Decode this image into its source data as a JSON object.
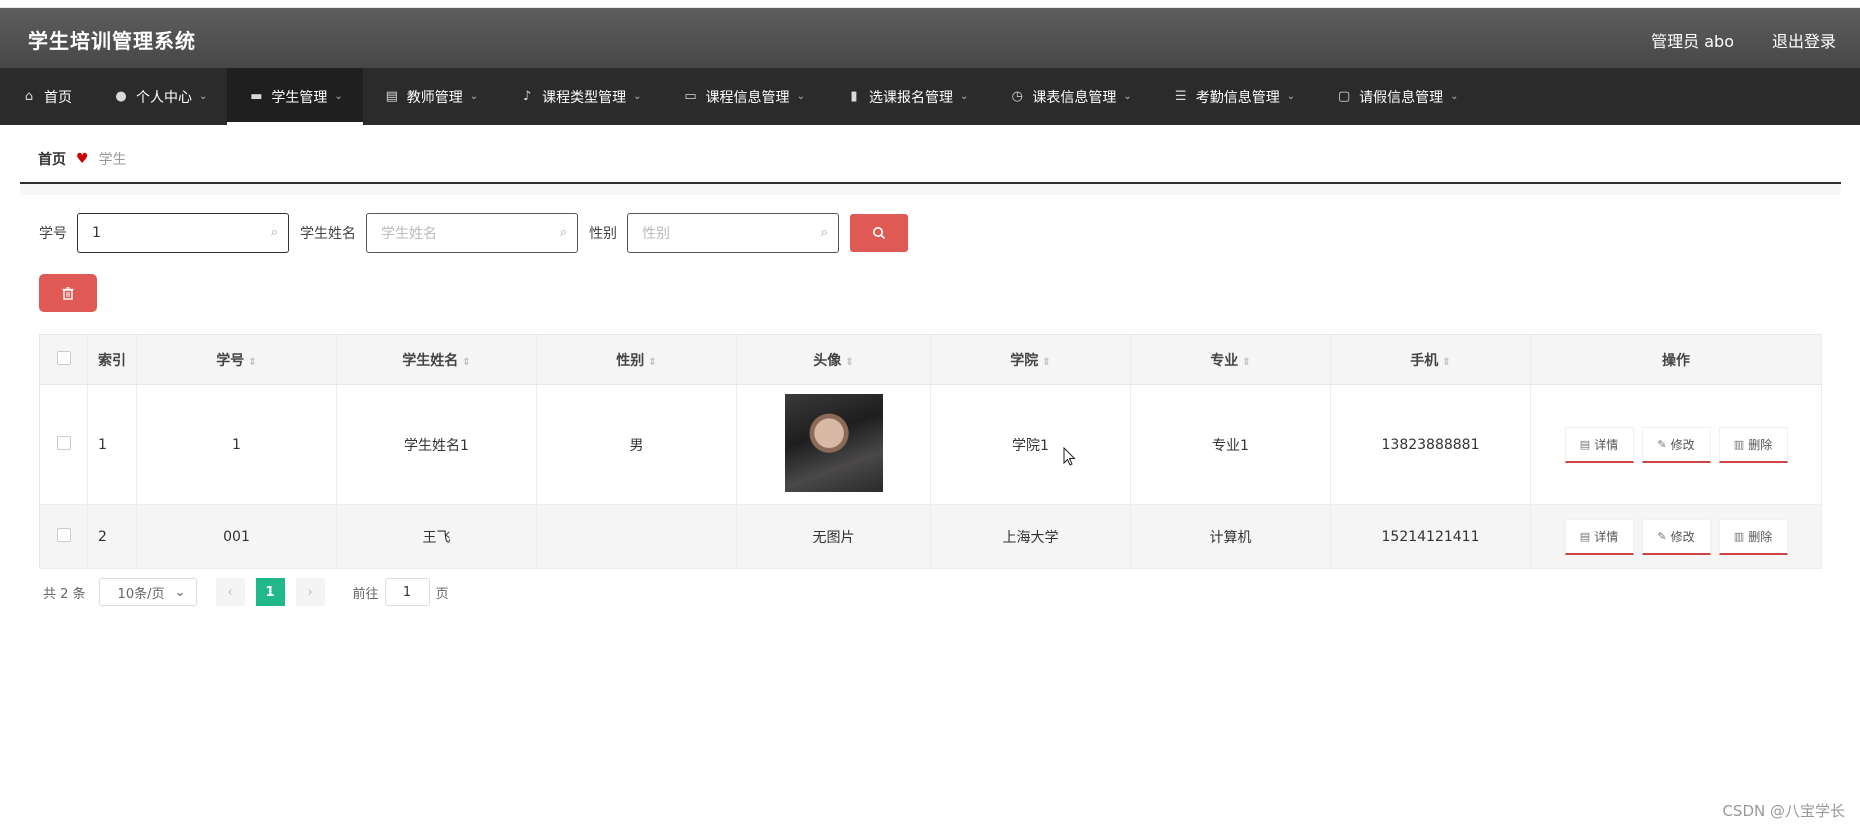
{
  "header": {
    "title": "学生培训管理系统",
    "user": "管理员 abo",
    "logout": "退出登录"
  },
  "nav": [
    {
      "label": "首页",
      "icon": "home-icon",
      "glyph": "⌂"
    },
    {
      "label": "个人中心",
      "icon": "person-icon",
      "glyph": "●",
      "dropdown": true
    },
    {
      "label": "学生管理",
      "icon": "monitor-icon",
      "glyph": "▬",
      "dropdown": true,
      "active": true
    },
    {
      "label": "教师管理",
      "icon": "clipboard-icon",
      "glyph": "▤",
      "dropdown": true
    },
    {
      "label": "课程类型管理",
      "icon": "microphone-icon",
      "glyph": "♪",
      "dropdown": true
    },
    {
      "label": "课程信息管理",
      "icon": "ticket-icon",
      "glyph": "▭",
      "dropdown": true
    },
    {
      "label": "选课报名管理",
      "icon": "bar-chart-icon",
      "glyph": "▮",
      "dropdown": true
    },
    {
      "label": "课表信息管理",
      "icon": "clock-icon",
      "glyph": "◷",
      "dropdown": true
    },
    {
      "label": "考勤信息管理",
      "icon": "list-icon",
      "glyph": "☰",
      "dropdown": true
    },
    {
      "label": "请假信息管理",
      "icon": "chat-icon",
      "glyph": "▢",
      "dropdown": true
    }
  ],
  "breadcrumb": {
    "home": "首页",
    "current": "学生"
  },
  "search": {
    "id_label": "学号",
    "id_value": "1",
    "name_label": "学生姓名",
    "name_placeholder": "学生姓名",
    "gender_label": "性别",
    "gender_placeholder": "性别"
  },
  "table": {
    "headers": [
      "索引",
      "学号",
      "学生姓名",
      "性别",
      "头像",
      "学院",
      "专业",
      "手机",
      "操作"
    ],
    "rows": [
      {
        "index": "1",
        "id": "1",
        "name": "学生姓名1",
        "gender": "男",
        "avatar": "",
        "college": "学院1",
        "major": "专业1",
        "phone": "13823888881"
      },
      {
        "index": "2",
        "id": "001",
        "name": "王飞",
        "gender": "",
        "avatar": "无图片",
        "college": "上海大学",
        "major": "计算机",
        "phone": "15214121411"
      }
    ],
    "actions": {
      "detail": "详情",
      "edit": "修改",
      "delete": "删除"
    }
  },
  "pager": {
    "total": "共 2 条",
    "page_size": "10条/页",
    "current": "1",
    "goto": "前往",
    "goto_value": "1",
    "page_unit": "页"
  },
  "watermark": "CSDN @八宝学长"
}
